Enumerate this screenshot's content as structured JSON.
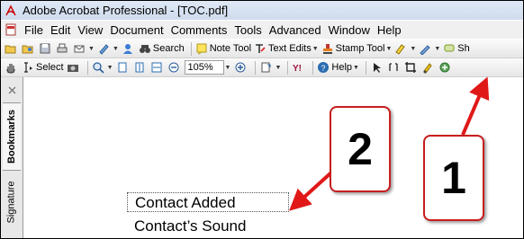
{
  "window": {
    "title": "Adobe Acrobat Professional - [TOC.pdf]"
  },
  "menubar": {
    "items": [
      "File",
      "Edit",
      "View",
      "Document",
      "Comments",
      "Tools",
      "Advanced",
      "Window",
      "Help"
    ]
  },
  "toolbar1": {
    "search_label": "Search",
    "note_tool_label": "Note Tool",
    "text_edits_label": "Text Edits",
    "stamp_tool_label": "Stamp Tool",
    "cut_label": "Sh"
  },
  "toolbar2": {
    "select_label": "Select",
    "zoom_value": "105%",
    "help_label": "Help"
  },
  "side_panel": {
    "tabs": [
      "Bookmarks",
      "Signature"
    ]
  },
  "document": {
    "toc_entries": [
      "Contact Added",
      "Contact’s Sound"
    ]
  },
  "callouts": [
    {
      "number": "2",
      "target": "toc-entry"
    },
    {
      "number": "1",
      "target": "toolbar-tool"
    }
  ],
  "colors": {
    "callout_border": "#c81d1d",
    "arrow": "#e01818"
  }
}
